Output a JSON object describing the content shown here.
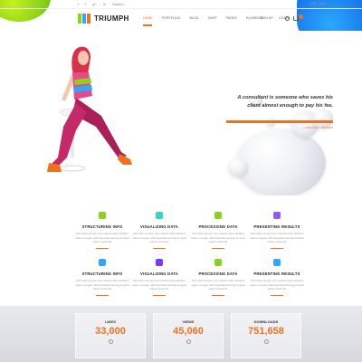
{
  "topbar": {
    "social": [
      "f",
      "t",
      "g+",
      "in"
    ],
    "search_label": "Search",
    "right": [
      "USD",
      "ENG"
    ]
  },
  "header": {
    "logo_text": "TRIUMPH",
    "nav": [
      "HOME",
      "PORTFOLIO",
      "BLOG",
      "SHOP",
      "PAGES",
      "ELEMENTS"
    ],
    "sign_in": "SIGN UP",
    "login": "LOGIN"
  },
  "hero": {
    "quote": "A consultant is someone who saves his client almost enough to pay his fee.",
    "author": "— ARNOLD H. GLASOW"
  },
  "features": [
    {
      "title": "Structuring Info",
      "desc": "Nam liber tempor cum soluta nobis eleifend option congue nihil imperdiet doming id quod mazim euismod.",
      "color": "#8ad11a"
    },
    {
      "title": "Visualizing Data",
      "desc": "Nam liber tempor cum soluta nobis eleifend option congue nihil imperdiet doming id quod mazim euismod.",
      "color": "#3ad1c4"
    },
    {
      "title": "Processing Data",
      "desc": "Nam liber tempor cum soluta nobis eleifend option congue nihil imperdiet doming id quod mazim euismod.",
      "color": "#8ad11a"
    },
    {
      "title": "Presenting Results",
      "desc": "Nam liber tempor cum soluta nobis eleifend option congue nihil imperdiet doming id quod mazim euismod.",
      "color": "#8a5cf0"
    },
    {
      "title": "Structuring Info",
      "desc": "Nam liber tempor cum soluta nobis eleifend option congue nihil imperdiet doming id quod mazim euismod.",
      "color": "#2ea8ff"
    },
    {
      "title": "Visualizing Data",
      "desc": "Nam liber tempor cum soluta nobis eleifend option congue nihil imperdiet doming id quod mazim euismod.",
      "color": "#7a3cf0"
    },
    {
      "title": "Processing Data",
      "desc": "Nam liber tempor cum soluta nobis eleifend option congue nihil imperdiet doming id quod mazim euismod.",
      "color": "#8ad11a"
    },
    {
      "title": "Presenting Results",
      "desc": "Nam liber tempor cum soluta nobis eleifend option congue nihil imperdiet doming id quod mazim euismod.",
      "color": "#2ea8ff"
    }
  ],
  "stats": [
    {
      "label": "LIKES",
      "value": "33,000"
    },
    {
      "label": "VIEWS",
      "value": "45,060"
    },
    {
      "label": "DOWNLOADS",
      "value": "751,658"
    }
  ],
  "colors": {
    "accent": "#f07020",
    "green": "#8fd11a",
    "blue": "#1572e8"
  }
}
